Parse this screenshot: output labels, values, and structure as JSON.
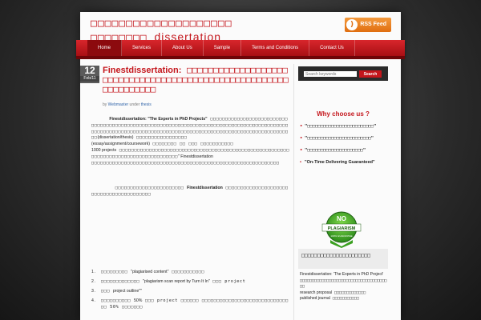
{
  "header": {
    "title_line1": "□□□□□□□□□□□□□□□□□□□□",
    "title_line2": "□□□□□□□□",
    "title_suffix": "dissertation",
    "rss_label": "RSS Feed",
    "rss_icon": "rss-icon"
  },
  "nav": {
    "items": [
      "Home",
      "Services",
      "About Us",
      "Sample",
      "Terms and Conditions",
      "Contact Us"
    ]
  },
  "post": {
    "date_day": "12",
    "date_month": "Feb/11",
    "title_lead": "Finestdissertation:",
    "title_rest": " □□□□□□□□□□□□□□□□□□□□□□□□□□□□□□□□□□□□□□□□□□□□□□□□□□□□□□□□□□□□□□□□",
    "by_prefix": "by",
    "author": "Webmaster",
    "under": "under",
    "category": "thesis",
    "intro_bold": "Finestdissertation: \"The Experts in PhD Projects\"",
    "para1": " □□□□□□□□□□□□□□□□□□□□□□□□□□□□□□□□□□□□□□□□□□□□□□□□□□□□□□□□□□□□□□□□□□□□□□□□□□□□□□□□□□□□□□□□□□□□□□□□□□□□□□□□□□□□□□□□□□□□□□□□□□□□□□□□□□□□□□□□□□□□□□□□□□□□□□□□□□□□□□□□",
    "term1": "(dissertation/thesis)",
    "para2": " □□□□□□□□□□□□□□□□□",
    "term2": "(essay/assignment/coursework)",
    "para3": " □□□□□□□□ □□ □□□ □□□□□□□□□□□",
    "term3": "1000 projects",
    "para4": " □□□□□□□□□□□□□□□□□□□□□□□□□□□□□□□□□□□□□□□□□□□□□□□□□□□□□□□□□□□□□□□□□□□□□□□□□□□□□□□□□□□□□□",
    "term4": "\" Finestdissertation",
    "para5": " □□□□□□□□□□□□□□□□□□□□□□□□□□□□□□□□□□□□□□□□□□□□□□□□□□□□□□□□□□□□□□□",
    "para6_prefix": "□□□□□□□□□□□□□□□□□□□□□□□ ",
    "para6_bold": "Finestdissertation",
    "para6_rest": " □□□□□□□□□□□□□□□□□□□□□□□□□□□□□□□□□□□□□□□□□",
    "list": [
      {
        "num": "1.",
        "pre": "□□□□□□□□□ ",
        "en": "\"plagiarised content\"",
        "post": " □□□□□□□□□□□"
      },
      {
        "num": "2.",
        "pre": "□□□□□□□□□□□□□ ",
        "en": "\"plagiarism scan report by Turn It In\"",
        "post": " □□□ project"
      },
      {
        "num": "3.",
        "pre": "□□□ ",
        "en": "project outline\"\"",
        "post": ""
      },
      {
        "num": "4.",
        "pre": "□□□□□□□□□□ ",
        "en": "50%",
        "post": " □□□ project □□□□□□ □□□□□□□□□□□□□□□□□□□□□□□□□□□□□□□ 50% □□□□□□□"
      }
    ]
  },
  "sidebar": {
    "search_placeholder": "Search keywords",
    "search_button": "Search",
    "why_title": "Why choose us ?",
    "reasons": [
      "\"□□□□□□□□□□□□□□□□□□□□□□□□□\"",
      "\"□□□□□□□□□□□□□□□□□□□□□□□□\"",
      "\"□□□□□□□□□□□□□□□□□□□□□\"",
      "\"On-Time Delivering Guaranteed\""
    ],
    "badge_title": "NO",
    "badge_text": "PLAGIARISM",
    "badge_sub": "100% GUARANTEE",
    "heading": "□□□□□□□□□□□□□□□□□□□□□□",
    "side_intro": "Finestdissertation: 'The Experts in PhD Project'",
    "side_text1": " □□□□□□□□□□□□□□□□□□□□□□□□□□□□□□□□□□□□□□",
    "side_en1": "research proposal",
    "side_text2": " □□□□□□□□□□□□□",
    "side_en2": "published journal",
    "side_text3": " □□□□□□□□□□□"
  }
}
